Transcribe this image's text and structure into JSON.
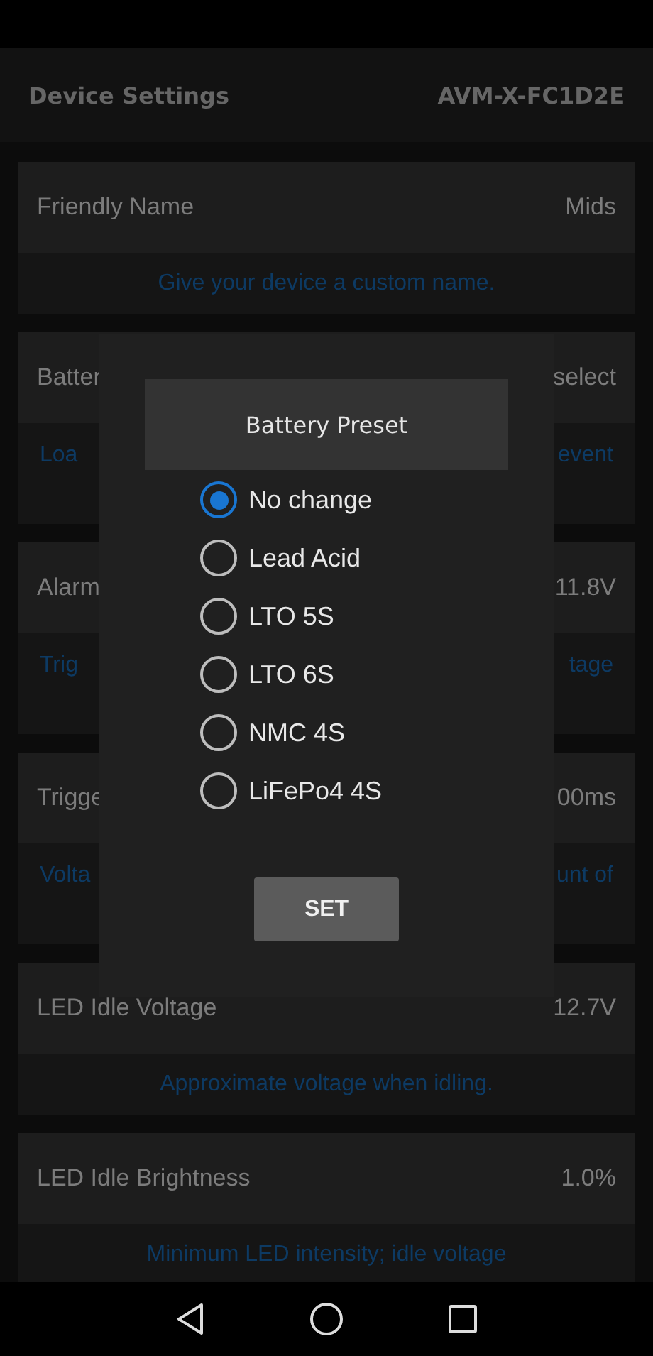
{
  "header": {
    "title": "Device Settings",
    "device_id": "AVM-X-FC1D2E"
  },
  "settings": [
    {
      "label": "Friendly Name",
      "value": "Mids",
      "description": [
        "Give your device a custom name."
      ]
    },
    {
      "label": "Batter",
      "value": "select",
      "description": [
        "Loa",
        "event"
      ]
    },
    {
      "label": "Alarm",
      "value": "11.8V",
      "description": [
        "Trig",
        "tage"
      ]
    },
    {
      "label": "Trigge",
      "value": "00ms",
      "description": [
        "Volta",
        "unt of"
      ]
    },
    {
      "label": "LED Idle Voltage",
      "value": "12.7V",
      "description": [
        "Approximate voltage when idling."
      ]
    },
    {
      "label": "LED Idle Brightness",
      "value": "1.0%",
      "description": [
        "Minimum LED intensity; idle voltage"
      ]
    }
  ],
  "dialog": {
    "title": "Battery Preset",
    "options": [
      {
        "label": "No change",
        "selected": true
      },
      {
        "label": "Lead Acid",
        "selected": false
      },
      {
        "label": "LTO 5S",
        "selected": false
      },
      {
        "label": "LTO 6S",
        "selected": false
      },
      {
        "label": "NMC 4S",
        "selected": false
      },
      {
        "label": "LiFePo4 4S",
        "selected": false
      }
    ],
    "button": "SET"
  }
}
